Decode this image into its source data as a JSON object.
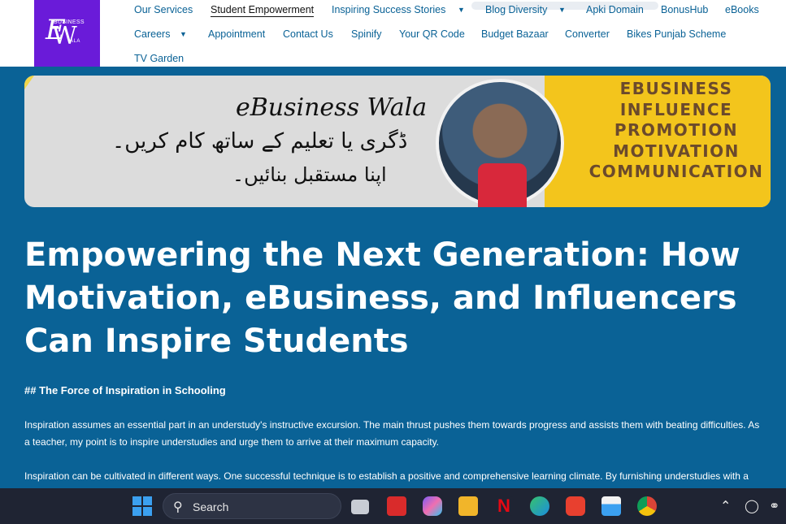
{
  "logo": {
    "top_word": "BUSINESS",
    "letter_e": "E",
    "letter_w": "W",
    "bottom_word": "ALA"
  },
  "nav": {
    "items": [
      {
        "label": "Our Services"
      },
      {
        "label": "Student Empowerment",
        "active": true
      },
      {
        "label": "Inspiring Success Stories",
        "dropdown": true
      },
      {
        "label": "Blog Diversity",
        "dropdown": true
      },
      {
        "label": "Apki Domain"
      },
      {
        "label": "BonusHub"
      },
      {
        "label": "eBooks"
      },
      {
        "label": "Careers",
        "dropdown": true
      },
      {
        "label": "Appointment"
      },
      {
        "label": "Contact Us"
      },
      {
        "label": "Spinify"
      },
      {
        "label": "Your QR Code"
      },
      {
        "label": "Budget Bazaar"
      },
      {
        "label": "Converter"
      },
      {
        "label": "Bikes Punjab Scheme"
      },
      {
        "label": "TV Garden"
      }
    ],
    "caret": "▼"
  },
  "banner": {
    "brand": "eBusiness Wala",
    "urdu_line1": "ڈگری یا تعلیم کے ساتھ کام کریں۔",
    "urdu_line2": "اپنا مستقبل بنائیں۔",
    "words": [
      "EBUSINESS",
      "INFLUENCE",
      "PROMOTION",
      "MOTIVATION",
      "COMMUNICATION"
    ],
    "accent_color": "#f3c51c"
  },
  "article": {
    "title": "Empowering the Next Generation: How Motivation, eBusiness, and Influencers Can Inspire Students",
    "subheading": "## The Force of Inspiration in Schooling",
    "paragraph1": "Inspiration assumes an essential part in an understudy's instructive excursion. The main thrust pushes them towards progress and assists them with beating difficulties. As a teacher, my point is to inspire understudies and urge them to arrive at their maximum capacity.",
    "paragraph2": "Inspiration can be cultivated in different ways. One successful technique is to establish a positive and comprehensive learning climate. By furnishing understudies with a"
  },
  "taskbar": {
    "search_label": "Search",
    "search_icon": "search-icon",
    "apps": [
      "task-view-icon",
      "acrobat-icon",
      "copilot-icon",
      "file-explorer-icon",
      "netflix-icon",
      "edge-icon",
      "wps-icon",
      "store-icon",
      "chrome-icon"
    ],
    "tray": [
      "chevron-up-icon",
      "copilot-tray-icon",
      "wifi-icon"
    ]
  },
  "colors": {
    "page_bg": "#0a6296",
    "logo_bg": "#6a1bd9",
    "link": "#0a6296",
    "taskbar": "#1f2433"
  }
}
